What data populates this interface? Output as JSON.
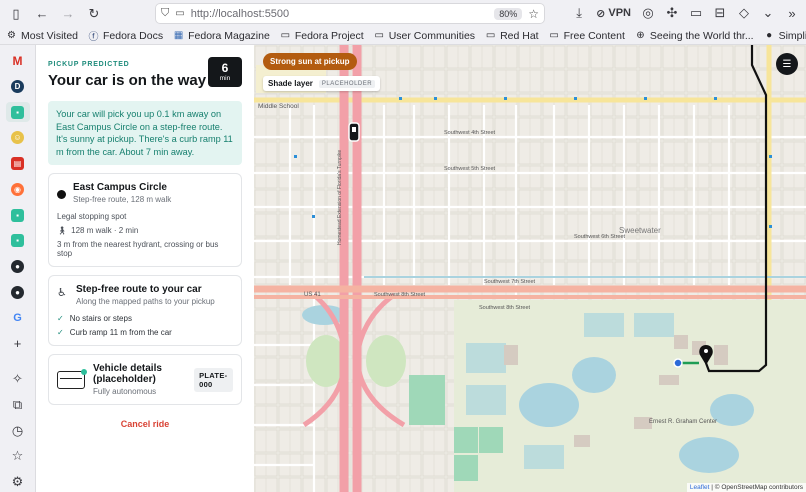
{
  "browser": {
    "url": "http://localhost:5500",
    "zoom": "80%",
    "vpn_label": "VPN",
    "bookmarks": [
      {
        "label": "Most Visited",
        "icon": "gear-icon"
      },
      {
        "label": "Fedora Docs",
        "icon": "fedora-icon"
      },
      {
        "label": "Fedora Magazine",
        "icon": "fedora-magazine-icon"
      },
      {
        "label": "Fedora Project",
        "icon": "folder-icon"
      },
      {
        "label": "User Communities",
        "icon": "folder-icon"
      },
      {
        "label": "Red Hat",
        "icon": "folder-icon"
      },
      {
        "label": "Free Content",
        "icon": "folder-icon"
      },
      {
        "label": "Seeing the World thr...",
        "icon": "globe-icon"
      },
      {
        "label": "SimplifyJobs/Summer...",
        "icon": "github-icon"
      }
    ]
  },
  "panel": {
    "eyebrow": "PICKUP PREDICTED",
    "title": "Your car is on the way",
    "eta_value": "6",
    "eta_unit": "min",
    "info": "Your car will pick you up 0.1 km away on East Campus Circle on a step-free route. It's sunny at pickup. There's a curb ramp 11 m from the car. About 7 min away.",
    "pickup": {
      "title": "East Campus Circle",
      "subtitle": "Step-free route, 128 m walk",
      "stop_type": "Legal stopping spot",
      "walk": "128 m walk · 2 min",
      "note": "3 m from the nearest hydrant, crossing or bus stop"
    },
    "route": {
      "title": "Step-free route to your car",
      "subtitle": "Along the mapped paths to your pickup",
      "checks": [
        "No stairs or steps",
        "Curb ramp 11 m from the car"
      ]
    },
    "vehicle": {
      "title": "Vehicle details (placeholder)",
      "subtitle": "Fully autonomous",
      "plate": "PLATE-000"
    },
    "cancel_label": "Cancel ride"
  },
  "map": {
    "sun_label": "Strong sun at pickup",
    "shade_label": "Shade layer",
    "shade_tag": "PLACEHOLDER",
    "street_labels": {
      "us41": "US 41",
      "sw8": "Southwest 8th Street",
      "sw8_b": "Southwest 8th Street",
      "sw7": "Southwest 7th Street",
      "sw6": "Southwest 6th Street",
      "sw5": "Southwest 5th Street",
      "sw4": "Southwest 4th Street",
      "turnpike": "Homestead Extension of Florida's Turnpike",
      "sweetwater": "Sweetwater",
      "campus": "Ernest R. Graham Center",
      "school": "Middle School"
    },
    "attribution_leaflet": "Leaflet",
    "attribution_osm": "© OpenStreetMap contributors"
  },
  "colors": {
    "accent": "#1f8c7c",
    "sun_pill": "#b35c10",
    "cancel": "#d94335",
    "route": "#111111",
    "walk": "#1f9d55"
  }
}
